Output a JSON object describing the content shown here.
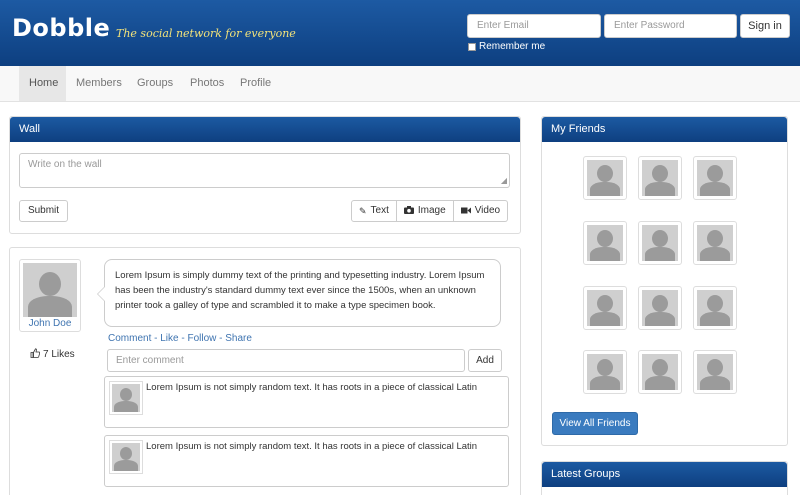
{
  "header": {
    "logo": "Dobble",
    "tagline": "The social network for everyone",
    "email_placeholder": "Enter Email",
    "password_placeholder": "Enter Password",
    "signin_label": "Sign in",
    "remember_label": "Remember me"
  },
  "nav": {
    "items": [
      {
        "label": "Home"
      },
      {
        "label": "Members"
      },
      {
        "label": "Groups"
      },
      {
        "label": "Photos"
      },
      {
        "label": "Profile"
      }
    ]
  },
  "wall": {
    "title": "Wall",
    "placeholder": "Write on the wall",
    "submit_label": "Submit",
    "text_label": "Text",
    "image_label": "Image",
    "video_label": "Video"
  },
  "post": {
    "author": "John Doe",
    "likes": "7 Likes",
    "body": "Lorem Ipsum is simply dummy text of the printing and typesetting industry. Lorem Ipsum has been the industry's standard dummy text ever since the 1500s, when an unknown printer took a galley of type and scrambled it to make a type specimen book.",
    "actions": "Comment - Like - Follow - Share",
    "comment_placeholder": "Enter comment",
    "add_label": "Add",
    "comments": [
      {
        "text": "Lorem Ipsum is not simply random text. It has roots in a piece of classical Latin"
      },
      {
        "text": "Lorem Ipsum is not simply random text. It has roots in a piece of classical Latin"
      }
    ]
  },
  "friends": {
    "title": "My Friends",
    "view_all_label": "View All Friends"
  },
  "groups": {
    "title": "Latest Groups"
  },
  "colors": {
    "header_blue": "#0d3f80",
    "link_blue": "#3f74b0",
    "tagline_yellow": "#f2e27a",
    "button_blue": "#3a7bbf"
  }
}
